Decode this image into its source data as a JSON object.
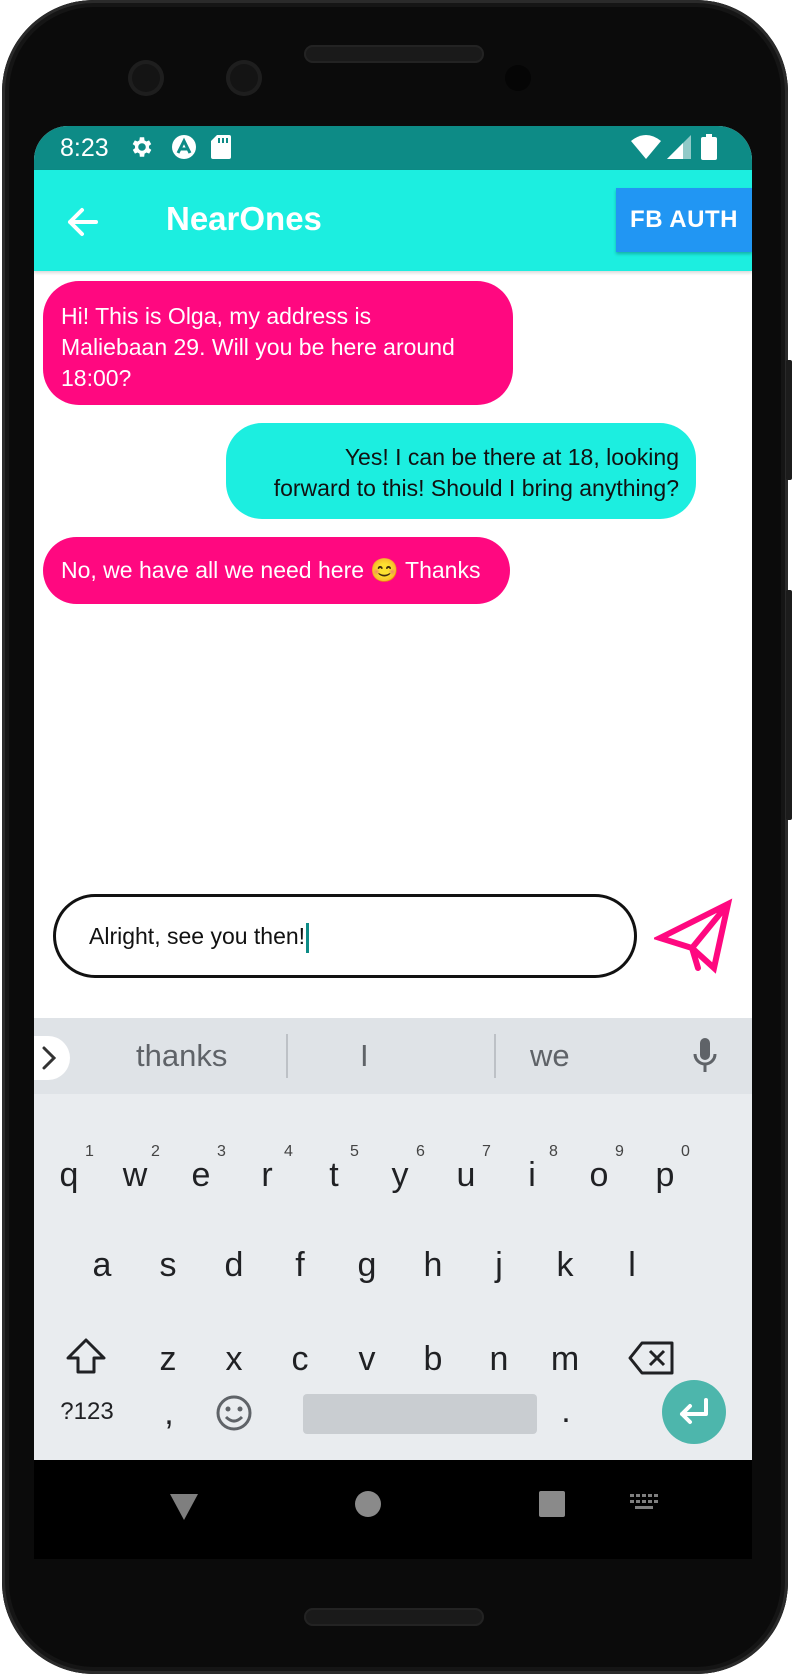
{
  "status_bar": {
    "time": "8:23",
    "icons_left": [
      "gear-icon",
      "app-a-icon",
      "sd-card-icon"
    ],
    "icons_right": [
      "wifi-icon",
      "signal-icon",
      "battery-icon"
    ],
    "color": "#0d8b86"
  },
  "app_bar": {
    "title": "NearOnes",
    "back_icon": "arrow-left-icon",
    "action_button": "FB AUTH",
    "color": "#1ceee0",
    "button_color": "#2196f3"
  },
  "messages": [
    {
      "direction": "incoming",
      "text": "Hi! This is Olga, my address is\nMaliebaan 29. Will you be here around\n18:00?"
    },
    {
      "direction": "outgoing",
      "text": "Yes! I can be there at 18, looking\nforward to this! Should I bring anything?"
    },
    {
      "direction": "incoming",
      "text": "No, we have all we need here 😊 Thanks"
    }
  ],
  "composer": {
    "value": "Alright, see you then!",
    "send_icon": "paper-plane-icon",
    "send_color": "#ff0880"
  },
  "keyboard": {
    "suggestions": [
      "thanks",
      "I",
      "we"
    ],
    "row1": [
      "q",
      "w",
      "e",
      "r",
      "t",
      "y",
      "u",
      "i",
      "o",
      "p"
    ],
    "row1_hints": [
      "1",
      "2",
      "3",
      "4",
      "5",
      "6",
      "7",
      "8",
      "9",
      "0"
    ],
    "row2": [
      "a",
      "s",
      "d",
      "f",
      "g",
      "h",
      "j",
      "k",
      "l"
    ],
    "row3": [
      "z",
      "x",
      "c",
      "v",
      "b",
      "n",
      "m"
    ],
    "symbols_label": "?123",
    "comma": ",",
    "period": "."
  }
}
